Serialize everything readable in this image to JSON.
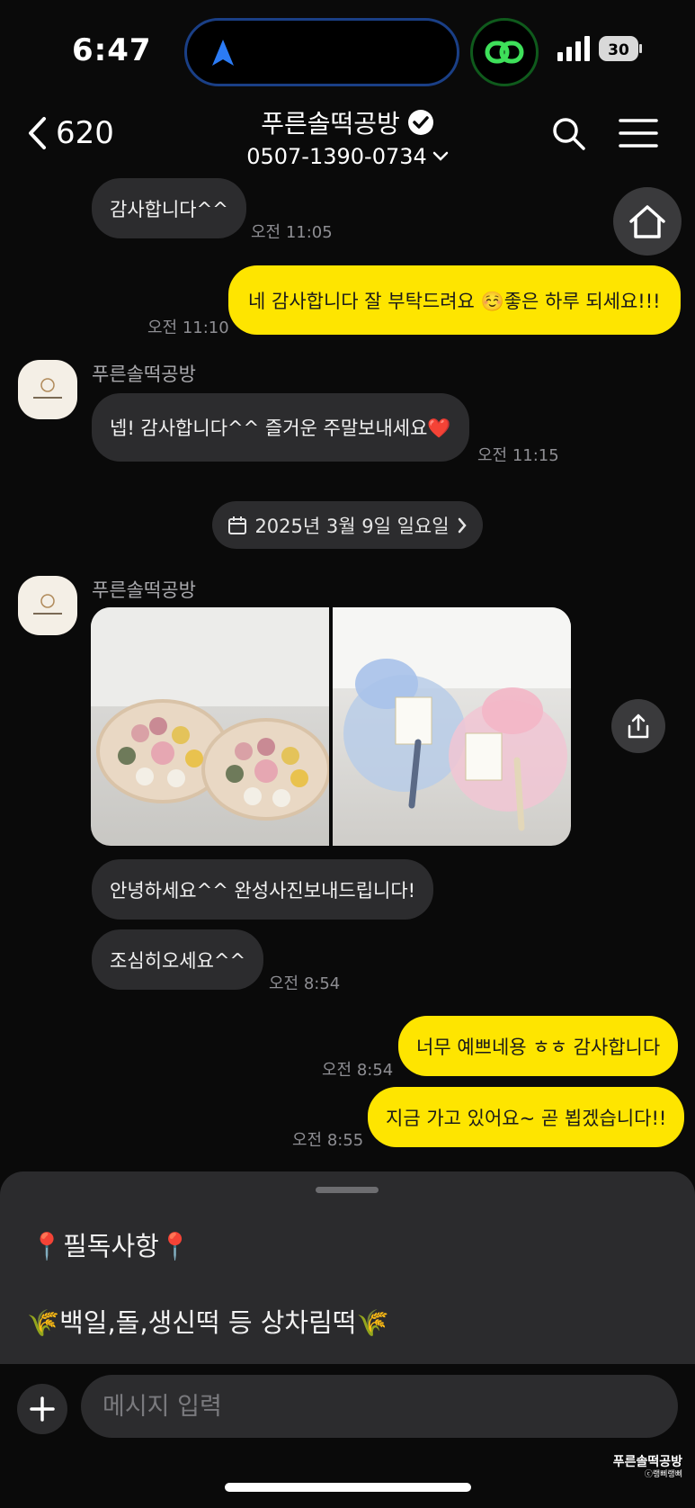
{
  "status": {
    "time": "6:47",
    "battery": "30"
  },
  "header": {
    "back_count": "620",
    "title": "푸른솔떡공방",
    "phone": "0507-1390-0734"
  },
  "messages": [
    {
      "dir": "in",
      "text": "감사합니다^^",
      "time": "오전 11:05"
    },
    {
      "dir": "out",
      "text": "네 감사합니다 잘 부탁드려요 ☺️좋은 하루 되세요!!!",
      "time": "오전 11:10"
    },
    {
      "dir": "in",
      "sender": "푸른솔떡공방",
      "text": "넵! 감사합니다^^ 즐거운 주말보내세요❤️",
      "time": "오전 11:15"
    },
    {
      "dir": "in",
      "sender": "푸른솔떡공방",
      "text": "안녕하세요^^ 완성사진보내드립니다!"
    },
    {
      "dir": "in",
      "text": "조심히오세요^^",
      "time": "오전 8:54"
    },
    {
      "dir": "out",
      "text": "너무 예쁘네용 ㅎㅎ 감사합니다",
      "time": "오전 8:54"
    },
    {
      "dir": "out",
      "text": "지금 가고 있어요~ 곧 뵙겠습니다!!",
      "time": "오전 8:55"
    }
  ],
  "date_divider": "2025년 3월 9일 일요일",
  "notice": {
    "line1": "📍필독사항📍",
    "line2": "🌾백일,돌,생신떡 등 상차림떡🌾"
  },
  "input": {
    "placeholder": "메시지 입력"
  },
  "watermark": {
    "name": "푸른솔떡공방",
    "sub": "ⓒ랭삐랭삐"
  },
  "colors": {
    "background": "#0a0a0a",
    "incoming": "#2c2c2e",
    "outgoing": "#fee500",
    "timestamp": "#8e8e93"
  }
}
